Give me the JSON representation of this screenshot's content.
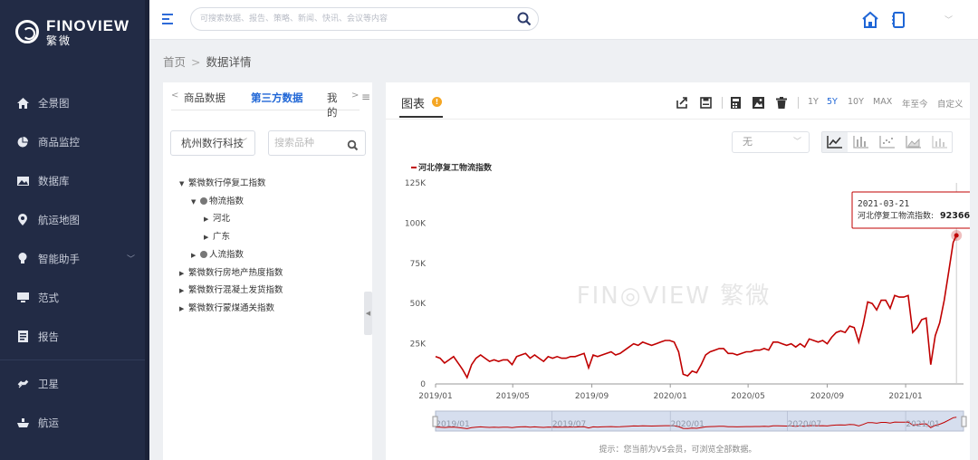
{
  "app": {
    "logo_en": "FINOVIEW",
    "logo_cn": "繁微"
  },
  "sidebar": {
    "items": [
      {
        "label": "全景图",
        "icon": "home-icon"
      },
      {
        "label": "商品监控",
        "icon": "pie-chart-icon"
      },
      {
        "label": "数据库",
        "icon": "image-icon"
      },
      {
        "label": "航运地图",
        "icon": "location-pin-icon"
      },
      {
        "label": "智能助手",
        "icon": "lightbulb-icon",
        "chevron": "﹀"
      },
      {
        "label": "范式",
        "icon": "monitor-icon"
      },
      {
        "label": "报告",
        "icon": "document-icon"
      },
      {
        "label": "卫星",
        "icon": "satellite-icon"
      },
      {
        "label": "航运",
        "icon": "ship-icon"
      }
    ]
  },
  "header": {
    "search_placeholder": "可搜索数据、报告、策略、新闻、快讯、会议等内容",
    "chevron": "﹀"
  },
  "breadcrumb": {
    "home": "首页",
    "sep": ">",
    "current": "数据详情"
  },
  "left_panel": {
    "tabs": [
      "商品数据",
      "第三方数据",
      "我的"
    ],
    "tab_prev": "<",
    "tab_next": ">",
    "tabs_menu": "≡",
    "source_select": "杭州数行科技",
    "select_caret": "﹀",
    "search_placeholder": "搜索品种",
    "tree": [
      {
        "label": "繁微数行停复工指数",
        "level": 0,
        "expanded": true,
        "dot": false
      },
      {
        "label": "物流指数",
        "level": 1,
        "expanded": true,
        "dot": true
      },
      {
        "label": "河北",
        "level": 2,
        "expanded": false,
        "dot": false
      },
      {
        "label": "广东",
        "level": 2,
        "expanded": false,
        "dot": false
      },
      {
        "label": "人流指数",
        "level": 1,
        "expanded": false,
        "dot": true
      },
      {
        "label": "繁微数行房地产热度指数",
        "level": 0,
        "expanded": false,
        "dot": false
      },
      {
        "label": "繁微数行混凝土发货指数",
        "level": 0,
        "expanded": false,
        "dot": false
      },
      {
        "label": "繁微数行蒙煤通关指数",
        "level": 0,
        "expanded": false,
        "dot": false
      }
    ],
    "collapse_glyph": "◀"
  },
  "right_panel": {
    "title": "图表",
    "info_glyph": "!",
    "ranges": [
      "1Y",
      "5Y",
      "10Y",
      "MAX",
      "年至今",
      "自定义"
    ],
    "active_range": "5Y",
    "option_select": "无",
    "option_caret": "﹀",
    "hint": "提示：您当前为V5会员，可浏览全部数据。"
  },
  "colors": {
    "series": "#c00000",
    "accent": "#1f66d6",
    "sidebar_bg": "#222b45"
  },
  "chart_data": {
    "type": "line",
    "legend": "河北停复工物流指数",
    "watermark": "FIN◎VIEW 繁微",
    "y_ticks": [
      "125K",
      "100K",
      "75K",
      "50K",
      "25K",
      "0"
    ],
    "x_ticks": [
      "2019/01",
      "2019/05",
      "2019/09",
      "2020/01",
      "2020/05",
      "2020/09",
      "2021/01"
    ],
    "navigator_ticks": [
      "2019/01",
      "2019/07",
      "2020/01",
      "2020/07",
      "2021/01"
    ],
    "ylim": [
      0,
      125000
    ],
    "x_start": "2019-01-01",
    "x_end": "2021-04-01",
    "tooltip": {
      "date": "2021-03-21",
      "label": "河北停复工物流指数:",
      "value": "92366"
    },
    "series": [
      {
        "name": "河北停复工物流指数",
        "x": [
          "2019-01-01",
          "2019-01-08",
          "2019-01-15",
          "2019-01-22",
          "2019-01-29",
          "2019-02-05",
          "2019-02-12",
          "2019-02-19",
          "2019-02-26",
          "2019-03-05",
          "2019-03-12",
          "2019-03-19",
          "2019-03-26",
          "2019-04-02",
          "2019-04-09",
          "2019-04-16",
          "2019-04-23",
          "2019-04-30",
          "2019-05-07",
          "2019-05-14",
          "2019-05-21",
          "2019-05-28",
          "2019-06-04",
          "2019-06-11",
          "2019-06-18",
          "2019-06-25",
          "2019-07-02",
          "2019-07-09",
          "2019-07-16",
          "2019-07-23",
          "2019-07-30",
          "2019-08-06",
          "2019-08-13",
          "2019-08-20",
          "2019-08-27",
          "2019-09-03",
          "2019-09-10",
          "2019-09-17",
          "2019-09-24",
          "2019-10-01",
          "2019-10-08",
          "2019-10-15",
          "2019-10-22",
          "2019-10-29",
          "2019-11-05",
          "2019-11-12",
          "2019-11-19",
          "2019-11-26",
          "2019-12-03",
          "2019-12-10",
          "2019-12-17",
          "2019-12-24",
          "2019-12-31",
          "2020-01-07",
          "2020-01-14",
          "2020-01-21",
          "2020-01-28",
          "2020-02-04",
          "2020-02-11",
          "2020-02-18",
          "2020-02-25",
          "2020-03-03",
          "2020-03-10",
          "2020-03-17",
          "2020-03-24",
          "2020-03-31",
          "2020-04-07",
          "2020-04-14",
          "2020-04-21",
          "2020-04-28",
          "2020-05-05",
          "2020-05-12",
          "2020-05-19",
          "2020-05-26",
          "2020-06-02",
          "2020-06-09",
          "2020-06-16",
          "2020-06-23",
          "2020-06-30",
          "2020-07-07",
          "2020-07-14",
          "2020-07-21",
          "2020-07-28",
          "2020-08-04",
          "2020-08-11",
          "2020-08-18",
          "2020-08-25",
          "2020-09-01",
          "2020-09-08",
          "2020-09-15",
          "2020-09-22",
          "2020-09-29",
          "2020-10-06",
          "2020-10-13",
          "2020-10-20",
          "2020-10-27",
          "2020-11-03",
          "2020-11-10",
          "2020-11-17",
          "2020-11-24",
          "2020-12-01",
          "2020-12-08",
          "2020-12-15",
          "2020-12-22",
          "2020-12-29",
          "2021-01-05",
          "2021-01-12",
          "2021-01-19",
          "2021-01-26",
          "2021-02-02",
          "2021-02-09",
          "2021-02-16",
          "2021-02-23",
          "2021-03-02",
          "2021-03-09",
          "2021-03-16",
          "2021-03-21"
        ],
        "values": [
          17000,
          16000,
          13000,
          15000,
          17000,
          13000,
          9000,
          4000,
          12000,
          16000,
          18000,
          16000,
          14000,
          15000,
          14000,
          15000,
          15000,
          12000,
          17000,
          18000,
          19000,
          16000,
          18000,
          16000,
          14000,
          17000,
          16000,
          17000,
          16000,
          16000,
          17000,
          17000,
          18000,
          19000,
          10000,
          18000,
          17000,
          18000,
          19000,
          20000,
          18000,
          19000,
          21000,
          23000,
          25000,
          24000,
          26000,
          25000,
          24000,
          25000,
          26000,
          27000,
          27000,
          26000,
          20000,
          6000,
          5000,
          8000,
          7000,
          12000,
          18000,
          20000,
          21000,
          22000,
          22000,
          19000,
          19000,
          18000,
          19000,
          20000,
          20000,
          21000,
          21000,
          22000,
          21000,
          26000,
          26000,
          25000,
          24000,
          25000,
          23000,
          25000,
          23000,
          28000,
          27000,
          26000,
          27000,
          25000,
          29000,
          32000,
          33000,
          32000,
          36000,
          35000,
          26000,
          37000,
          51000,
          50000,
          46000,
          52000,
          52000,
          47000,
          55000,
          54000,
          54000,
          55000,
          32000,
          35000,
          40000,
          41000,
          12000,
          30000,
          38000,
          52000,
          70000,
          88000,
          92366
        ]
      }
    ]
  }
}
